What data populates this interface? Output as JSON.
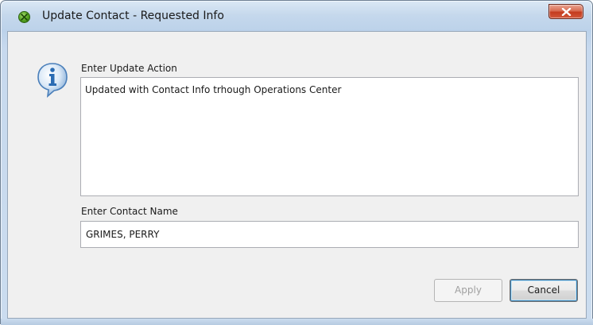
{
  "window": {
    "title": "Update Contact - Requested Info",
    "app_icon": "green-app-icon",
    "close_icon": "close-x-icon"
  },
  "form": {
    "info_icon": "information-icon",
    "update_action_label": "Enter Update Action",
    "update_action_value": "Updated with Contact Info trhough Operations Center",
    "contact_name_label": "Enter Contact Name",
    "contact_name_value": "GRIMES, PERRY"
  },
  "buttons": {
    "apply_label": "Apply",
    "apply_enabled": false,
    "cancel_label": "Cancel"
  },
  "colors": {
    "close_button": "#c43b1e",
    "titlebar": "#c5d8ec",
    "client_bg": "#f0f0f0",
    "info_icon_blue": "#2b6cb3"
  }
}
